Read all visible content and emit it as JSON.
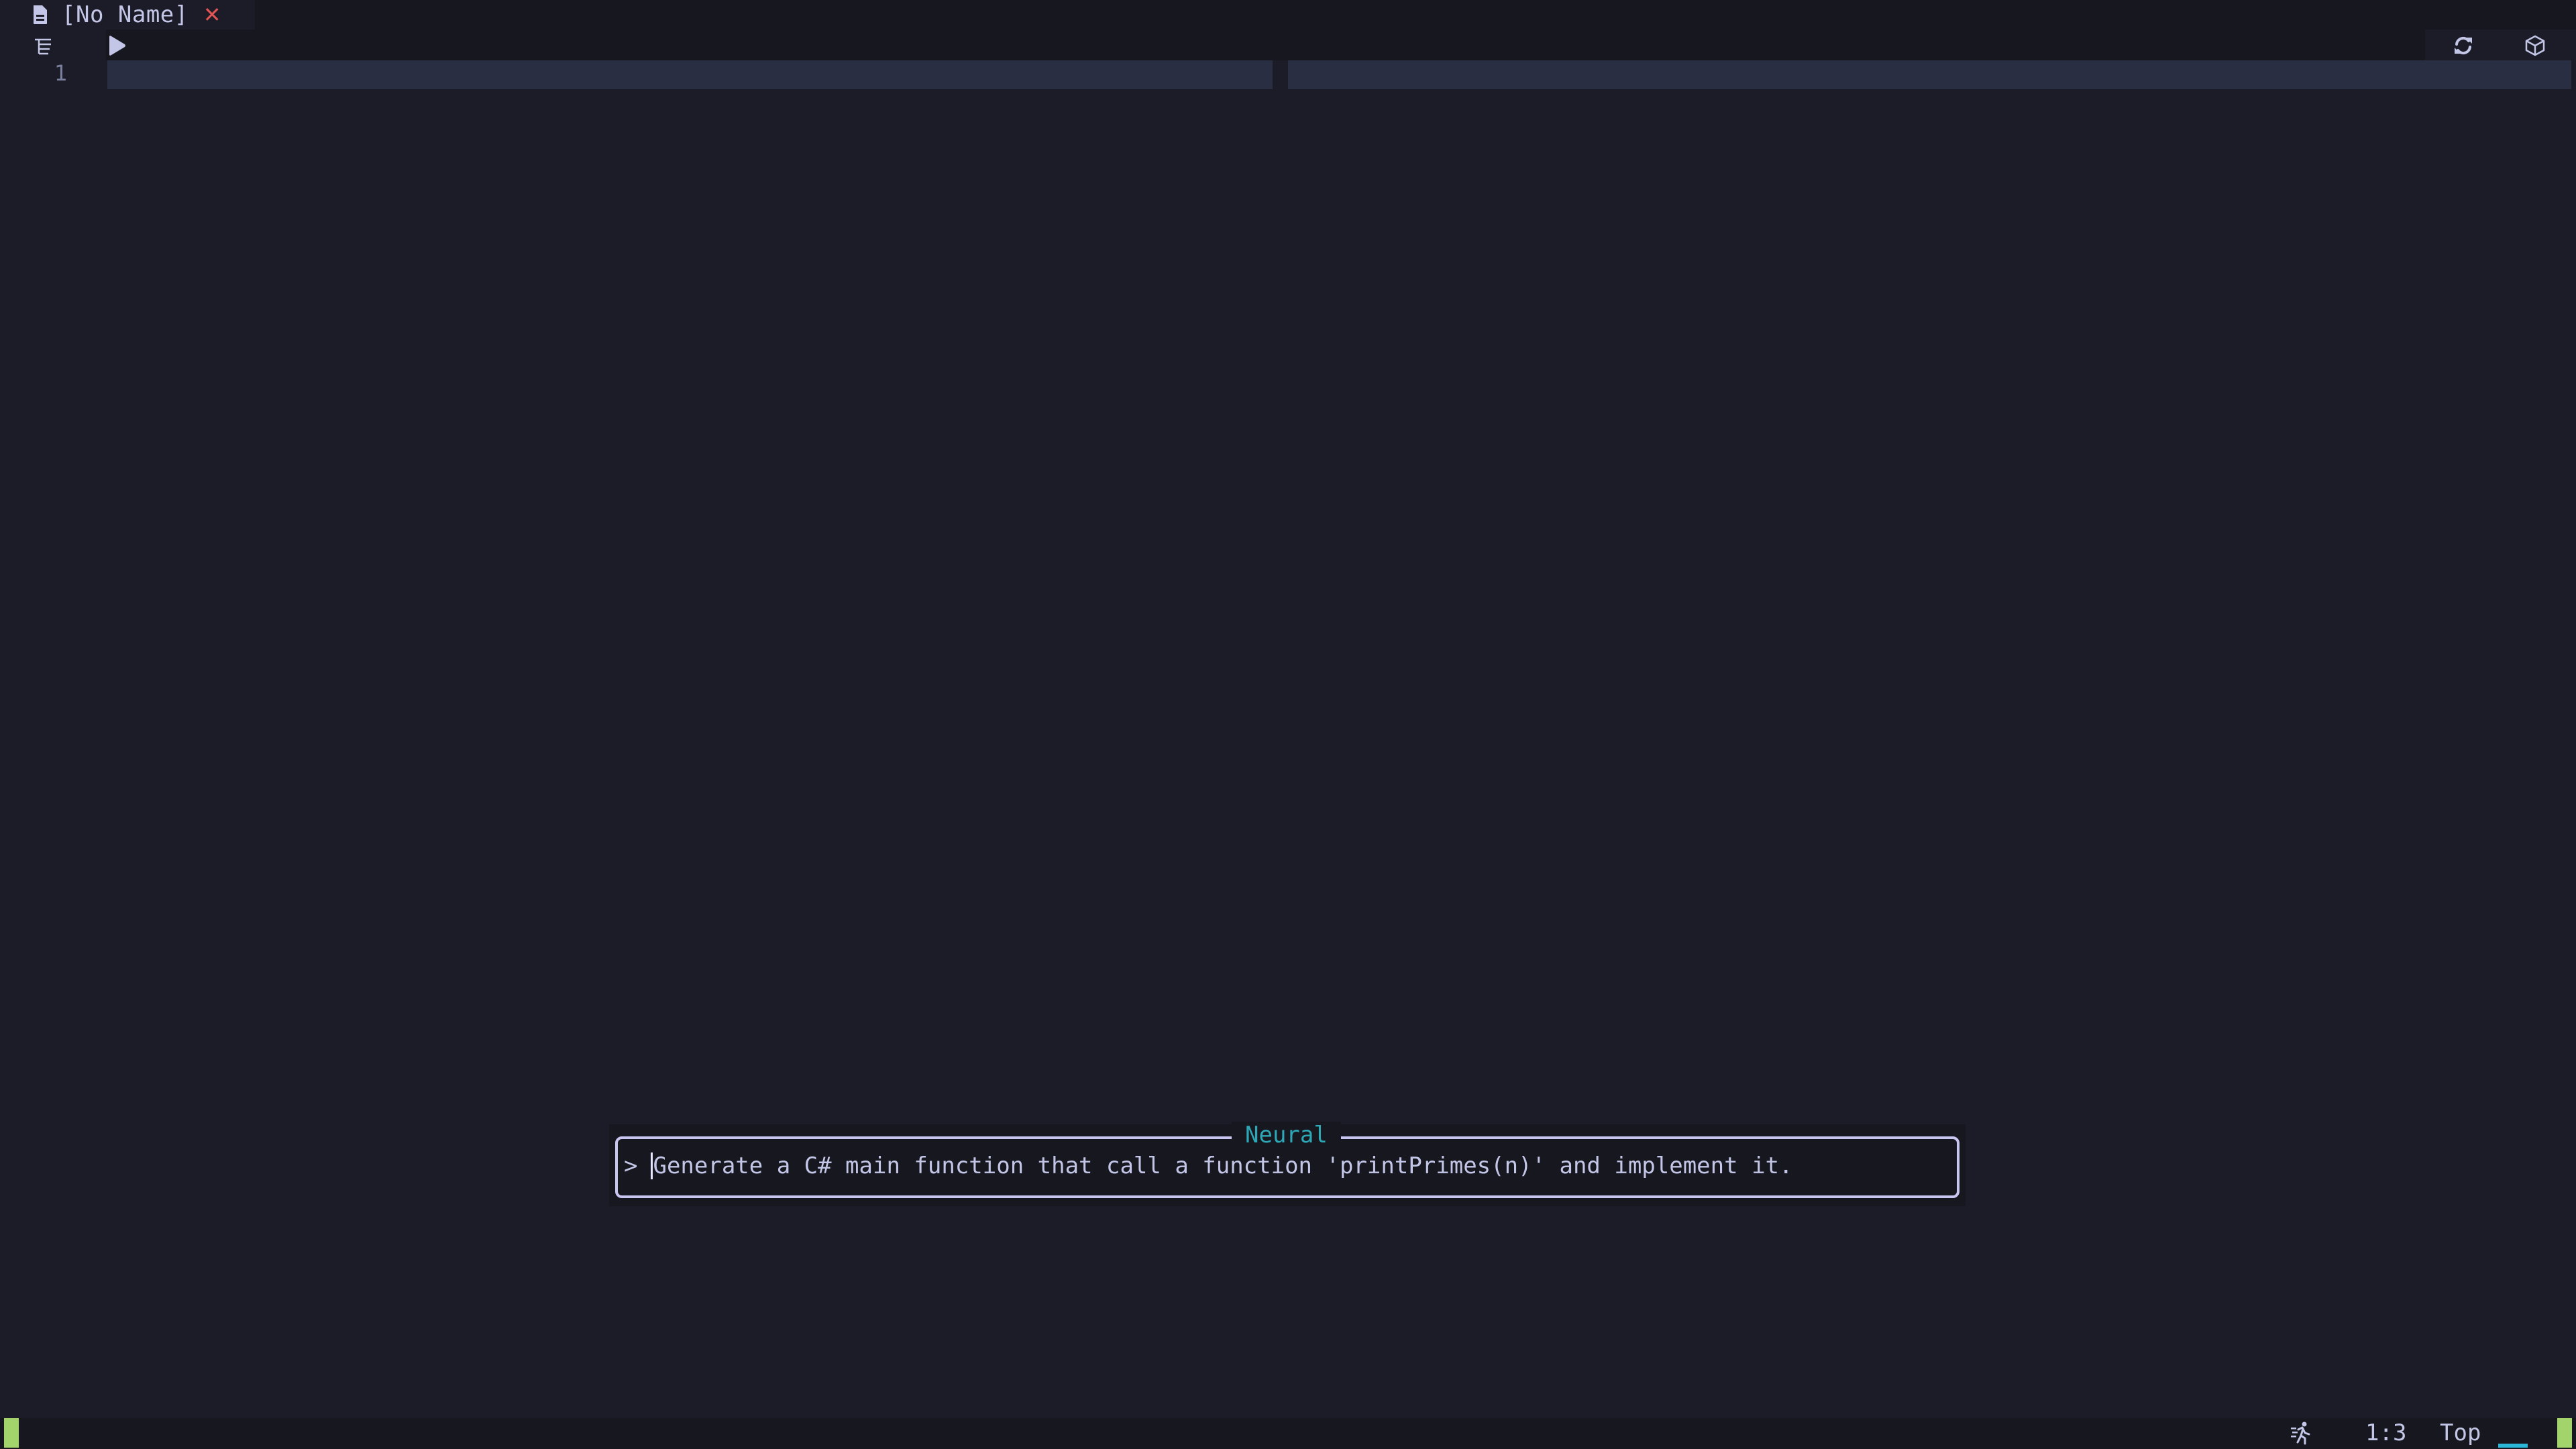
{
  "tabline": {
    "tabs": [
      {
        "title": "[No Name]",
        "icon": "file-icon",
        "close_icon": "close-icon",
        "close_glyph": "✕"
      }
    ]
  },
  "winbar": {
    "left_icons": [
      "outline-icon",
      "run-icon"
    ],
    "right_icons": [
      "refresh-icon",
      "package-icon"
    ]
  },
  "editor": {
    "line_numbers": [
      "1"
    ],
    "lines": [
      ""
    ]
  },
  "popup": {
    "title": "Neural",
    "prompt_symbol": ">",
    "input_value": "Generate a C# main function that call a function 'printPrimes(n)' and implement it.",
    "border_color": "#c8c6f0",
    "title_color": "#2ea8b6"
  },
  "statusbar": {
    "mode_color": "#a3d36b",
    "icon": "running-person-icon",
    "position": "1:3",
    "scroll": "Top",
    "progress_color": "#2bb6d8"
  },
  "colors": {
    "background": "#1b1c27",
    "cursorline": "#2a2e42",
    "close": "#e05555"
  }
}
